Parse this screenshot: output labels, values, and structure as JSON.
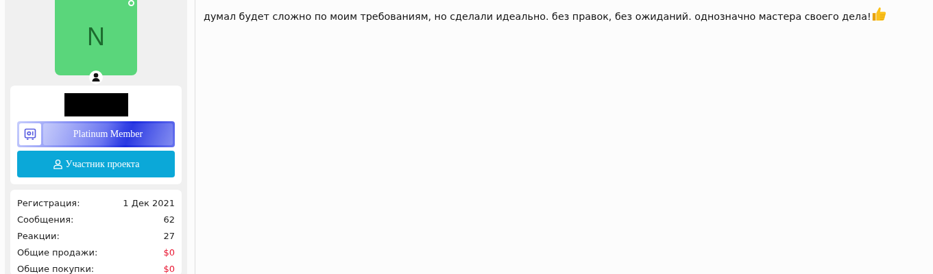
{
  "user": {
    "avatar_letter": "N",
    "online": true,
    "banner": {
      "label": "Platinum Member"
    },
    "role": {
      "label": "Участник проекта"
    },
    "stats": [
      {
        "label": "Регистрация:",
        "value": "1 Дек 2021",
        "kind": "plain"
      },
      {
        "label": "Сообщения:",
        "value": "62",
        "kind": "plain"
      },
      {
        "label": "Реакции:",
        "value": "27",
        "kind": "plain"
      },
      {
        "label": "Общие продажи:",
        "value": "$0",
        "kind": "money"
      },
      {
        "label": "Общие покупки:",
        "value": "$0",
        "kind": "money"
      }
    ]
  },
  "post": {
    "text": "думал будет сложно по моим требованиям, но сделали идеально. без правок, без ожиданий. однозначно мастера своего дела!"
  }
}
